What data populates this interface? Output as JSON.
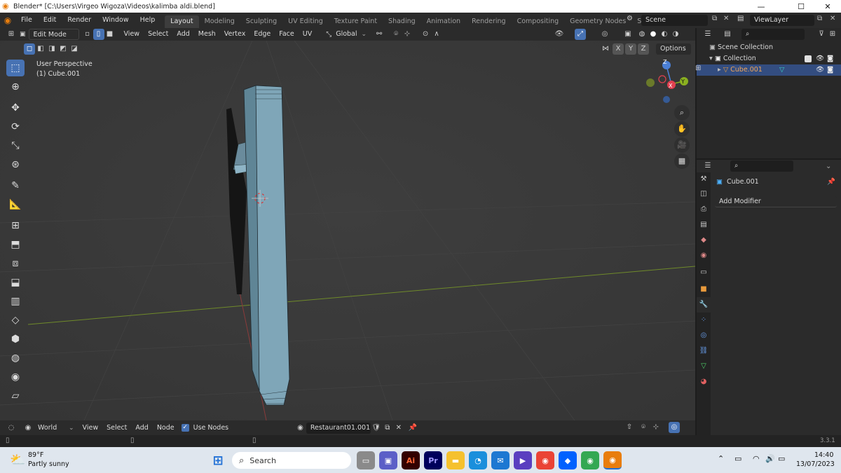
{
  "window": {
    "title": "Blender* [C:\\Users\\Virgeo Wigoza\\Videos\\kalimba aldi.blend]",
    "minimize": "—",
    "maximize": "☐",
    "close": "✕"
  },
  "menu": {
    "items": [
      "File",
      "Edit",
      "Render",
      "Window",
      "Help"
    ]
  },
  "workspaces": {
    "tabs": [
      "Layout",
      "Modeling",
      "Sculpting",
      "UV Editing",
      "Texture Paint",
      "Shading",
      "Animation",
      "Rendering",
      "Compositing",
      "Geometry Nodes",
      "Scripting"
    ],
    "active": "Layout",
    "add": "+"
  },
  "scene": {
    "name": "Scene",
    "view_layer": "ViewLayer"
  },
  "viewport_header": {
    "mode": "Edit Mode",
    "menus": [
      "View",
      "Select",
      "Add",
      "Mesh",
      "Vertex",
      "Edge",
      "Face",
      "UV"
    ],
    "orientation": "Global",
    "options": "Options",
    "axes": [
      "X",
      "Y",
      "Z"
    ]
  },
  "viewport": {
    "perspective": "User Perspective",
    "object": "(1) Cube.001",
    "gizmo": {
      "z": "Z",
      "y": "Y",
      "x": "X"
    },
    "colors": {
      "bg": "#3a3a3a",
      "mesh": "#7fa6b8",
      "x_axis": "#8a3b3b",
      "y_axis": "#6f8a2a"
    }
  },
  "outliner": {
    "rows": [
      {
        "label": "Scene Collection"
      },
      {
        "label": "Collection"
      },
      {
        "label": "Cube.001"
      }
    ]
  },
  "properties": {
    "object_name": "Cube.001",
    "add_modifier": "Add Modifier"
  },
  "bottom_header": {
    "world": "World",
    "menus": [
      "View",
      "Select",
      "Add",
      "Node"
    ],
    "use_nodes": "Use Nodes",
    "material": "Restaurant01.001"
  },
  "status": {
    "version": "3.3.1"
  },
  "taskbar": {
    "weather_temp": "89°F",
    "weather_desc": "Partly sunny",
    "search": "Search",
    "time": "14:40",
    "date": "13/07/2023"
  }
}
